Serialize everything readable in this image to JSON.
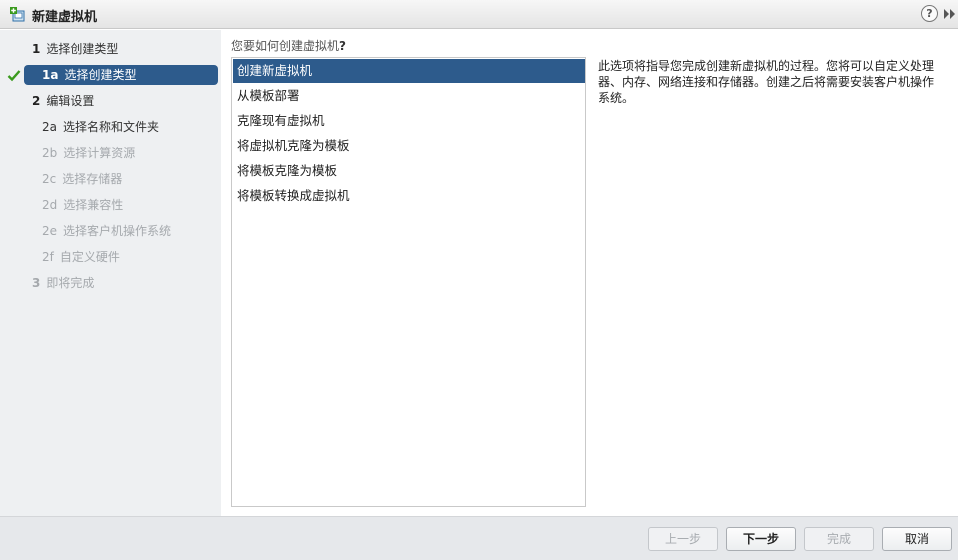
{
  "window": {
    "title": "新建虚拟机",
    "help_label": "?"
  },
  "wizard": {
    "steps": [
      {
        "num": "1",
        "label": "选择创建类型"
      },
      {
        "num": "1a",
        "label": "选择创建类型"
      },
      {
        "num": "2",
        "label": "编辑设置"
      },
      {
        "num": "2a",
        "label": "选择名称和文件夹"
      },
      {
        "num": "2b",
        "label": "选择计算资源"
      },
      {
        "num": "2c",
        "label": "选择存储器"
      },
      {
        "num": "2d",
        "label": "选择兼容性"
      },
      {
        "num": "2e",
        "label": "选择客户机操作系统"
      },
      {
        "num": "2f",
        "label": "自定义硬件"
      },
      {
        "num": "3",
        "label": "即将完成"
      }
    ]
  },
  "main": {
    "question_text": "您要如何创建虚拟机",
    "question_mark": "?",
    "options": [
      "创建新虚拟机",
      "从模板部署",
      "克隆现有虚拟机",
      "将虚拟机克隆为模板",
      "将模板克隆为模板",
      "将模板转换成虚拟机"
    ],
    "selected_index": 0,
    "description": "此选项将指导您完成创建新虚拟机的过程。您将可以自定义处理器、内存、网络连接和存储器。创建之后将需要安装客户机操作系统。"
  },
  "footer": {
    "back_label": "上一步",
    "next_label": "下一步",
    "finish_label": "完成",
    "cancel_label": "取消"
  },
  "colors": {
    "selection": "#2d5b8c",
    "check": "#3a9a1d"
  },
  "icons": {
    "title": "new-vm-icon",
    "help": "help-icon",
    "expand": "double-chevron-right-icon",
    "step_done": "check-icon"
  }
}
